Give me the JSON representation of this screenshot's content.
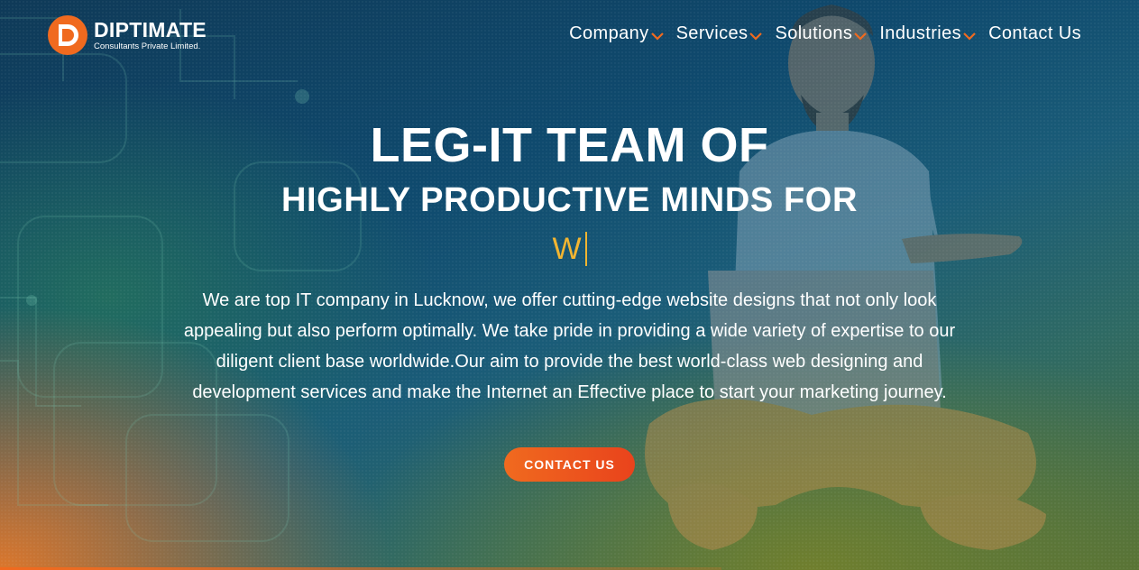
{
  "brand": {
    "name": "DIPTIMATE",
    "subtitle": "Consultants Private Limited.",
    "accent": "#f06a1f"
  },
  "nav": {
    "items": [
      {
        "label": "Company",
        "has_dropdown": true
      },
      {
        "label": "Services",
        "has_dropdown": true
      },
      {
        "label": "Solutions",
        "has_dropdown": true
      },
      {
        "label": "Industries",
        "has_dropdown": true
      },
      {
        "label": "Contact Us",
        "has_dropdown": false
      }
    ]
  },
  "hero": {
    "headline": "LEG-IT TEAM OF",
    "subheadline": "HIGHLY PRODUCTIVE MINDS FOR",
    "typed_text": "W",
    "typed_color": "#f2b531",
    "description": "We are top IT company in Lucknow, we offer cutting-edge website designs that not only look appealing but also perform optimally. We take pride in providing a wide variety of expertise to our diligent client base worldwide.Our aim to provide the best world-class web designing and development services and make the Internet an Effective place to start your marketing journey.",
    "cta_label": "CONTACT US"
  },
  "icons": {
    "logo": "diptimate-logo-icon",
    "dropdown": "chevron-down-icon"
  }
}
